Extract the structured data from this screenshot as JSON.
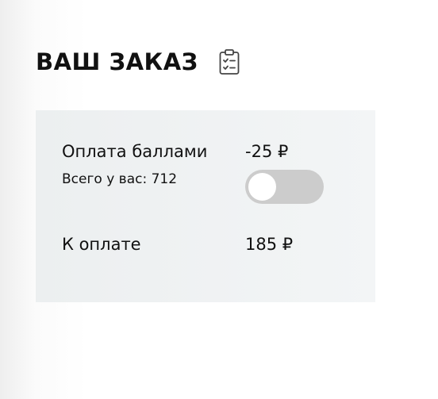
{
  "header": {
    "title": "ВАШ ЗАКАЗ"
  },
  "icons": {
    "clipboard": "clipboard-checklist-icon"
  },
  "points_payment": {
    "label": "Оплата баллами",
    "balance_text": "Всего у вас: 712",
    "discount": "-25 ₽",
    "toggle_on": false
  },
  "total": {
    "label": "К оплате",
    "amount": "185 ₽"
  },
  "colors": {
    "card_background": "#eff2f3",
    "toggle_track": "#cccccc",
    "toggle_knob": "#ffffff",
    "text": "#111111"
  }
}
